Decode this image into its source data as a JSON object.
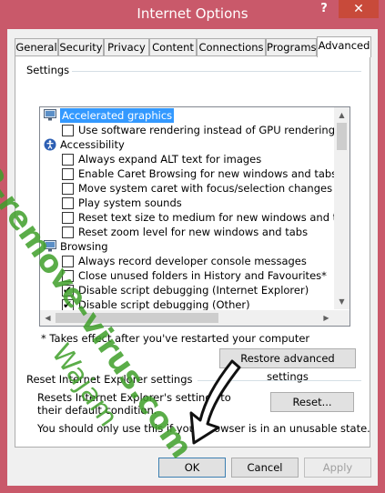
{
  "window": {
    "title": "Internet Options",
    "help_label": "?",
    "close_label": "✕"
  },
  "tabs": [
    "General",
    "Security",
    "Privacy",
    "Content",
    "Connections",
    "Programs",
    "Advanced"
  ],
  "settings": {
    "group_label": "Settings",
    "rows": [
      {
        "type": "category",
        "icon": "monitor-icon",
        "label": "Accelerated graphics",
        "selected": true
      },
      {
        "type": "check",
        "checked": false,
        "label": "Use software rendering instead of GPU rendering*"
      },
      {
        "type": "category",
        "icon": "accessibility-icon",
        "label": "Accessibility"
      },
      {
        "type": "check",
        "checked": false,
        "label": "Always expand ALT text for images"
      },
      {
        "type": "check",
        "checked": false,
        "label": "Enable Caret Browsing for new windows and tabs"
      },
      {
        "type": "check",
        "checked": false,
        "label": "Move system caret with focus/selection changes"
      },
      {
        "type": "check",
        "checked": false,
        "label": "Play system sounds"
      },
      {
        "type": "check",
        "checked": false,
        "label": "Reset text size to medium for new windows and tabs"
      },
      {
        "type": "check",
        "checked": false,
        "label": "Reset zoom level for new windows and tabs"
      },
      {
        "type": "category",
        "icon": "browsing-icon",
        "label": "Browsing"
      },
      {
        "type": "check",
        "checked": false,
        "label": "Always record developer console messages"
      },
      {
        "type": "check",
        "checked": false,
        "label": "Close unused folders in History and Favourites*"
      },
      {
        "type": "check",
        "checked": true,
        "label": "Disable script debugging (Internet Explorer)"
      },
      {
        "type": "check",
        "checked": true,
        "label": "Disable script debugging (Other)"
      }
    ],
    "note": "* Takes effect after you've restarted your computer",
    "restore_button": "Restore advanced settings"
  },
  "reset": {
    "group_label": "Reset Internet Explorer settings",
    "description": "Resets Internet Explorer's settings to their default condition.",
    "warning": "You should only use this if your browser is in an unusable state.",
    "reset_button": "Reset..."
  },
  "footer": {
    "ok": "OK",
    "cancel": "Cancel",
    "apply": "Apply"
  },
  "watermark": {
    "line1": "2-remove-virus.com",
    "line2": "Wajam"
  },
  "colors": {
    "title_bar": "#c9596a",
    "close": "#c84a3a",
    "selection": "#3399ff",
    "watermark": "#3f9f2a"
  }
}
